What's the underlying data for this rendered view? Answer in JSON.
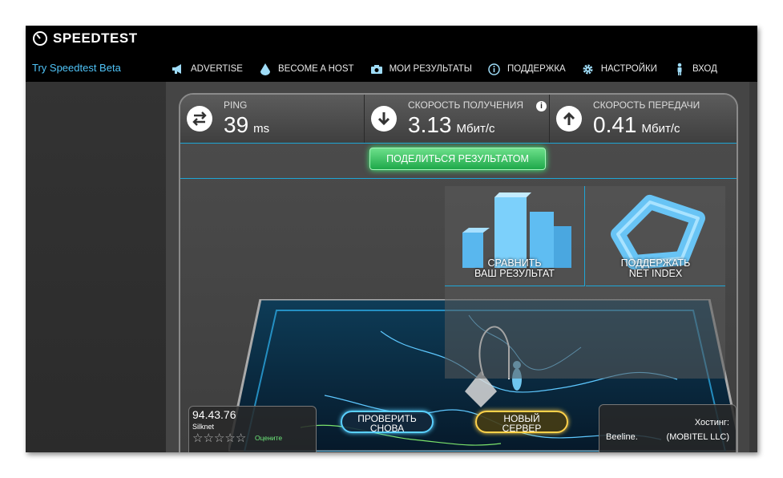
{
  "app": {
    "title": "SPEEDTEST",
    "beta_link": "Try Speedtest Beta"
  },
  "nav": [
    {
      "label": "ADVERTISE",
      "icon": "megaphone-icon"
    },
    {
      "label": "BECOME A HOST",
      "icon": "droplet-icon"
    },
    {
      "label": "МОИ РЕЗУЛЬТАТЫ",
      "icon": "camera-icon"
    },
    {
      "label": "ПОДДЕРЖКА",
      "icon": "info-icon"
    },
    {
      "label": "НАСТРОЙКИ",
      "icon": "gear-icon"
    },
    {
      "label": "ВХОД",
      "icon": "person-icon"
    }
  ],
  "stats": {
    "ping": {
      "label": "PING",
      "value": "39",
      "unit": "ms",
      "icon": "ping-arrows-icon"
    },
    "download": {
      "label": "СКОРОСТЬ ПОЛУЧЕНИЯ",
      "value": "3.13",
      "unit": "Мбит/с",
      "icon": "download-arrow-icon"
    },
    "upload": {
      "label": "СКОРОСТЬ ПЕРЕДАЧИ",
      "value": "0.41",
      "unit": "Мбит/с",
      "icon": "upload-arrow-icon"
    }
  },
  "share_button": "ПОДЕЛИТЬСЯ РЕЗУЛЬТАТОМ",
  "tiles": {
    "compare": {
      "line1": "СРАВНИТЬ",
      "line2": "ВАШ РЕЗУЛЬТАТ"
    },
    "netindex": {
      "line1": "ПОДДЕРЖАТЬ",
      "line2": "NET INDEX"
    }
  },
  "client": {
    "ip": "94.43.76",
    "isp": "Silknet",
    "rate_label": "Оцените",
    "stars": 0
  },
  "buttons": {
    "retry_line1": "ПРОВЕРИТЬ",
    "retry_line2": "СНОВА",
    "server_line1": "НОВЫЙ",
    "server_line2": "СЕРВЕР"
  },
  "host": {
    "label": "Хостинг:",
    "city": "Beeline.",
    "name": "(MOBITEL LLC)"
  },
  "colors": {
    "accent_blue": "#1ea6d6",
    "share_green": "#1ea84a",
    "server_gold": "#ffd24a"
  }
}
